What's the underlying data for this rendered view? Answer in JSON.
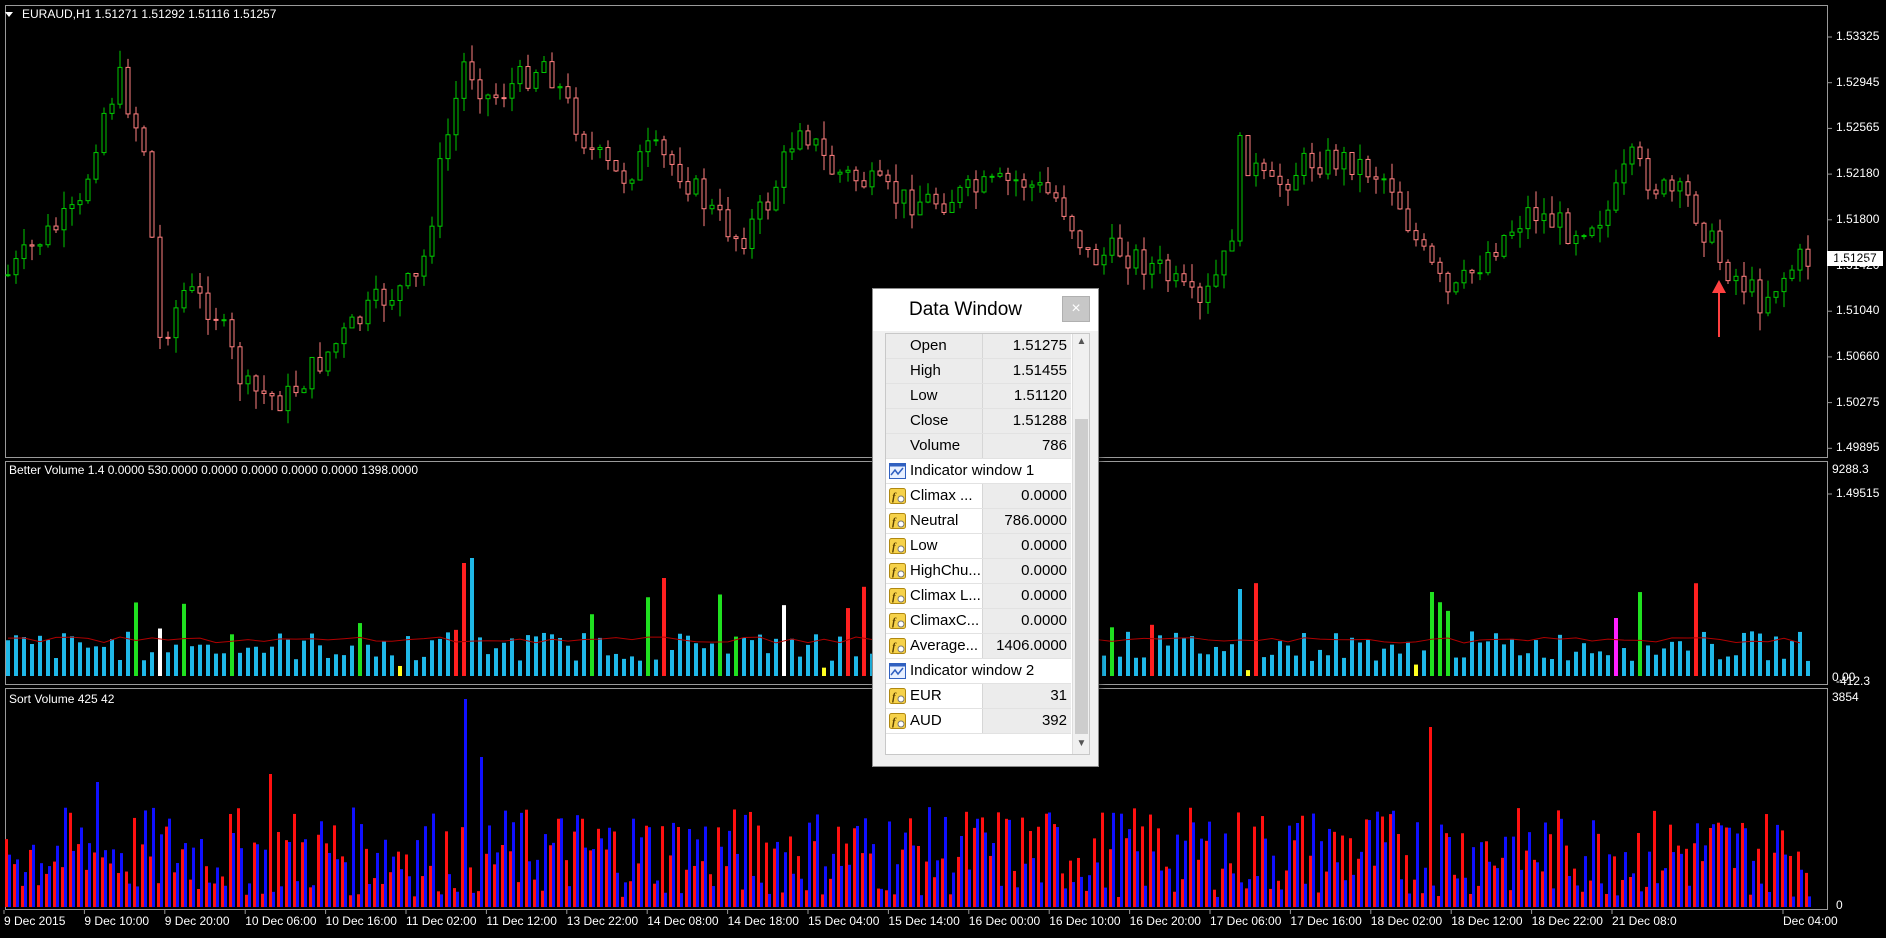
{
  "symbol_header": "EURAUD,H1  1.51271 1.51292 1.51116 1.51257",
  "current_price": "1.51257",
  "price_axis": [
    "1.53325",
    "1.52945",
    "1.52565",
    "1.52180",
    "1.51800",
    "1.51420",
    "1.51040",
    "1.50660",
    "1.50275",
    "1.49895",
    "1.49515"
  ],
  "indicator1": {
    "title": "Better Volume 1.4 0.0000 530.0000 0.0000 0.0000 0.0000 0.0000 1398.0000",
    "scale_top": "9288.3",
    "scale_bottom": "0.00",
    "scale_bottom2": "-412.3"
  },
  "indicator2": {
    "title": "Sort Volume 425 42",
    "scale_top": "3854",
    "scale_bottom": "0"
  },
  "time_axis": [
    "9 Dec 2015",
    "9 Dec 10:00",
    "9 Dec 20:00",
    "10 Dec 06:00",
    "10 Dec 16:00",
    "11 Dec 02:00",
    "11 Dec 12:00",
    "13 Dec 22:00",
    "14 Dec 08:00",
    "14 Dec 18:00",
    "15 Dec 04:00",
    "15 Dec 14:00",
    "16 Dec 00:00",
    "16 Dec 10:00",
    "16 Dec 20:00",
    "17 Dec 06:00",
    "17 Dec 16:00",
    "18 Dec 02:00",
    "18 Dec 12:00",
    "18 Dec 22:00",
    "21 Dec 08:0",
    "Dec 04:00"
  ],
  "colors": {
    "bull": "#00c800",
    "bear": "#ff7f7f",
    "vol_neutral": "#1fb8e8",
    "vol_climax": "#ff2020",
    "vol_green": "#20e020",
    "vol_low": "#ffff20",
    "vol_white": "#ffffff",
    "vol_magenta": "#ff20ff",
    "sort_red": "#ff1010",
    "sort_blue": "#1010ff",
    "average_line": "#b00000",
    "arrow": "#ff4040"
  },
  "data_window": {
    "title": "Data Window",
    "close_label": "×",
    "rows": [
      {
        "label": "Open",
        "value": "1.51275",
        "icon": "none"
      },
      {
        "label": "High",
        "value": "1.51455",
        "icon": "none"
      },
      {
        "label": "Low",
        "value": "1.51120",
        "icon": "none"
      },
      {
        "label": "Close",
        "value": "1.51288",
        "icon": "none"
      },
      {
        "label": "Volume",
        "value": "786",
        "icon": "none"
      },
      {
        "label": "Indicator window 1",
        "value": "",
        "icon": "indicator-window-icon",
        "section": true
      },
      {
        "label": "Climax ...",
        "value": "0.0000",
        "icon": "function-icon"
      },
      {
        "label": "Neutral",
        "value": "786.0000",
        "icon": "function-icon"
      },
      {
        "label": "Low",
        "value": "0.0000",
        "icon": "function-icon"
      },
      {
        "label": "HighChu...",
        "value": "0.0000",
        "icon": "function-icon"
      },
      {
        "label": "Climax L...",
        "value": "0.0000",
        "icon": "function-icon"
      },
      {
        "label": "ClimaxC...",
        "value": "0.0000",
        "icon": "function-icon"
      },
      {
        "label": "Average...",
        "value": "1406.0000",
        "icon": "function-icon"
      },
      {
        "label": "Indicator window 2",
        "value": "",
        "icon": "indicator-window-icon",
        "section": true
      },
      {
        "label": "EUR",
        "value": "31",
        "icon": "function-icon"
      },
      {
        "label": "AUD",
        "value": "392",
        "icon": "function-icon"
      }
    ]
  }
}
